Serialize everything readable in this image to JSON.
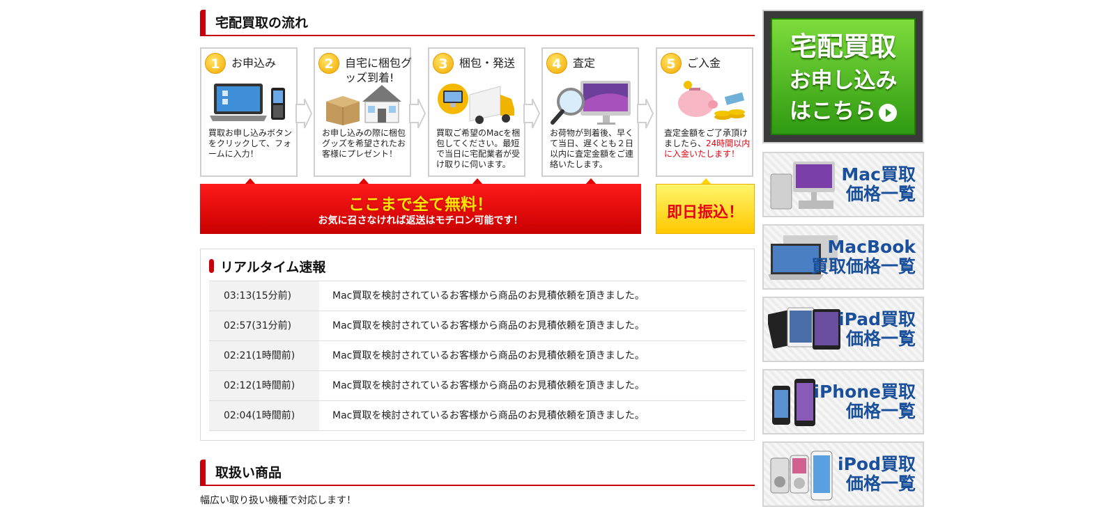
{
  "flow": {
    "title": "宅配買取の流れ",
    "steps": [
      {
        "num": "1",
        "title": "お申込み",
        "desc": "買取お申し込みボタンをクリックして、フォームに入力！",
        "desc_red": ""
      },
      {
        "num": "2",
        "title": "自宅に梱包グッズ到着!",
        "desc": "お申し込みの際に梱包グッズを希望されたお客様にプレゼント！",
        "desc_red": ""
      },
      {
        "num": "3",
        "title": "梱包・発送",
        "desc": "買取ご希望のMacを梱包してください。最短で当日に宅配業者が受け取りに伺います。",
        "desc_red": ""
      },
      {
        "num": "4",
        "title": "査定",
        "desc": "お荷物が到着後、早くて当日、遅くとも２日以内に査定金額をご連絡いたします。",
        "desc_red": ""
      },
      {
        "num": "5",
        "title": "ご入金",
        "desc": "査定金額をご了承頂けましたら、",
        "desc_red": "24時間以内に入金いたします！"
      }
    ],
    "free_banner": {
      "line1": "ここまで全て無料！",
      "line2": "お気に召さなければ返送はモチロン可能です！"
    },
    "pay_banner": "即日振込！"
  },
  "realtime": {
    "title": "リアルタイム速報",
    "rows": [
      {
        "time": "03:13(15分前)",
        "msg": "Mac買取を検討されているお客様から商品のお見積依頼を頂きました。"
      },
      {
        "time": "02:57(31分前)",
        "msg": "Mac買取を検討されているお客様から商品のお見積依頼を頂きました。"
      },
      {
        "time": "02:21(1時間前)",
        "msg": "Mac買取を検討されているお客様から商品のお見積依頼を頂きました。"
      },
      {
        "time": "02:12(1時間前)",
        "msg": "Mac買取を検討されているお客様から商品のお見積依頼を頂きました。"
      },
      {
        "time": "02:04(1時間前)",
        "msg": "Mac買取を検討されているお客様から商品のお見積依頼を頂きました。"
      }
    ]
  },
  "products": {
    "title": "取扱い商品",
    "subtitle": "幅広い取り扱い機種で対応します！"
  },
  "sidebar": {
    "apply": {
      "line1": "宅配買取",
      "line2": "お申し込み",
      "line3": "はこちら"
    },
    "categories": [
      {
        "line1": "Mac買取",
        "line2": "価格一覧"
      },
      {
        "line1": "MacBook",
        "line2": "買取価格一覧"
      },
      {
        "line1": "iPad買取",
        "line2": "価格一覧"
      },
      {
        "line1": "iPhone買取",
        "line2": "価格一覧"
      },
      {
        "line1": "iPod買取",
        "line2": "価格一覧"
      }
    ]
  },
  "colors": {
    "accent_red": "#c8000a",
    "link_blue": "#1a4f9c",
    "green": "#2f9a12",
    "yellow": "#ffc800"
  }
}
